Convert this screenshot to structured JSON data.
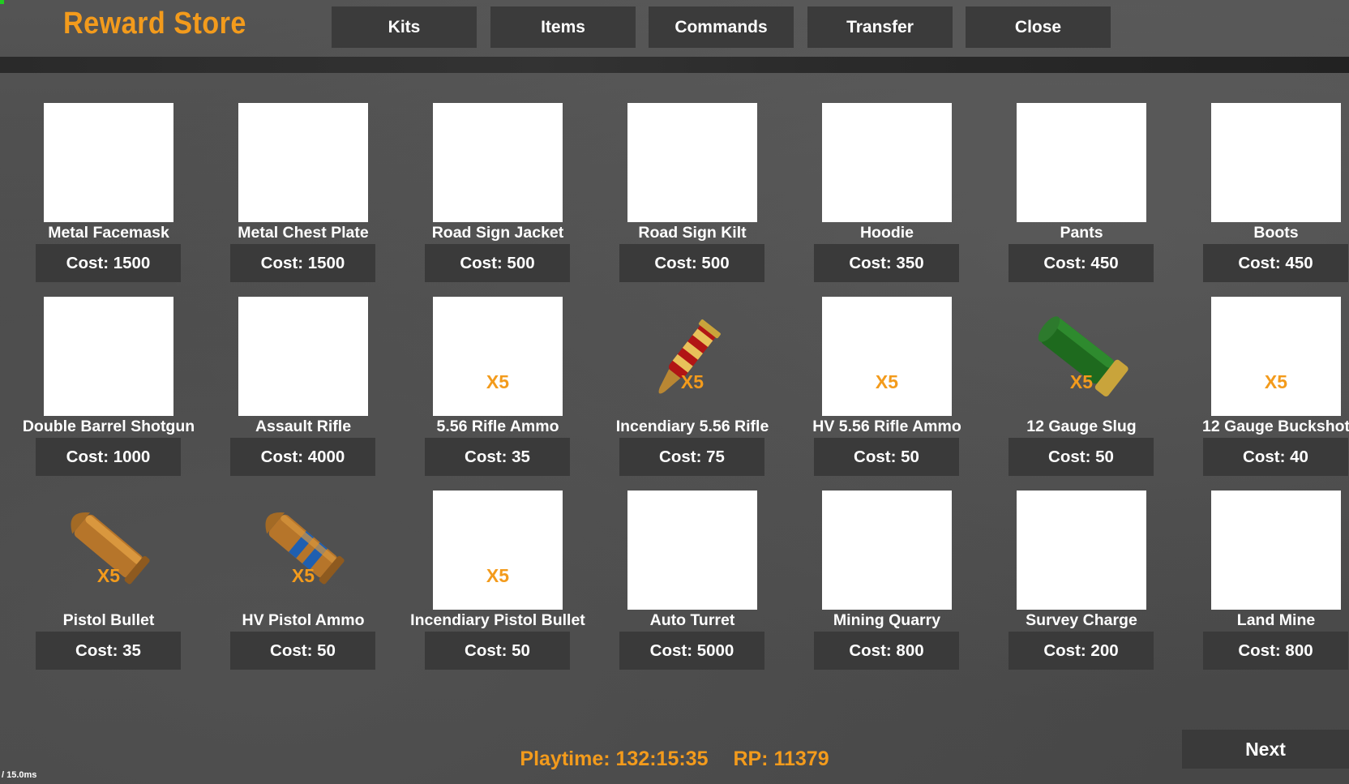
{
  "header": {
    "title": "Reward Store",
    "nav": [
      {
        "label": "Kits"
      },
      {
        "label": "Items"
      },
      {
        "label": "Commands"
      },
      {
        "label": "Transfer"
      },
      {
        "label": "Close"
      }
    ]
  },
  "items": [
    {
      "name": "Metal Facemask",
      "cost": "Cost: 1500",
      "qty": "",
      "icon": "blank-slot-icon"
    },
    {
      "name": "Metal Chest Plate",
      "cost": "Cost: 1500",
      "qty": "",
      "icon": "blank-slot-icon"
    },
    {
      "name": "Road Sign Jacket",
      "cost": "Cost: 500",
      "qty": "",
      "icon": "blank-slot-icon"
    },
    {
      "name": "Road Sign Kilt",
      "cost": "Cost: 500",
      "qty": "",
      "icon": "blank-slot-icon"
    },
    {
      "name": "Hoodie",
      "cost": "Cost: 350",
      "qty": "",
      "icon": "blank-slot-icon"
    },
    {
      "name": "Pants",
      "cost": "Cost: 450",
      "qty": "",
      "icon": "blank-slot-icon"
    },
    {
      "name": "Boots",
      "cost": "Cost: 450",
      "qty": "",
      "icon": "blank-slot-icon"
    },
    {
      "name": "Double Barrel Shotgun",
      "cost": "Cost: 1000",
      "qty": "",
      "icon": "blank-slot-icon"
    },
    {
      "name": "Assault Rifle",
      "cost": "Cost: 4000",
      "qty": "",
      "icon": "blank-slot-icon"
    },
    {
      "name": "5.56 Rifle Ammo",
      "cost": "Cost: 35",
      "qty": "X5",
      "icon": "blank-slot-icon"
    },
    {
      "name": "Incendiary 5.56 Rifle",
      "cost": "Cost: 75",
      "qty": "X5",
      "icon": "incendiary-rifle-bullet-icon"
    },
    {
      "name": "HV 5.56 Rifle Ammo",
      "cost": "Cost: 50",
      "qty": "X5",
      "icon": "blank-slot-icon"
    },
    {
      "name": "12 Gauge Slug",
      "cost": "Cost: 50",
      "qty": "X5",
      "icon": "shotgun-slug-shell-icon"
    },
    {
      "name": "12 Gauge Buckshot",
      "cost": "Cost: 40",
      "qty": "X5",
      "icon": "blank-slot-icon"
    },
    {
      "name": "Pistol Bullet",
      "cost": "Cost: 35",
      "qty": "X5",
      "icon": "pistol-bullet-icon"
    },
    {
      "name": "HV Pistol Ammo",
      "cost": "Cost: 50",
      "qty": "X5",
      "icon": "hv-pistol-bullet-icon"
    },
    {
      "name": "Incendiary Pistol Bullet",
      "cost": "Cost: 50",
      "qty": "X5",
      "icon": "blank-slot-icon"
    },
    {
      "name": "Auto Turret",
      "cost": "Cost: 5000",
      "qty": "",
      "icon": "blank-slot-icon"
    },
    {
      "name": "Mining Quarry",
      "cost": "Cost: 800",
      "qty": "",
      "icon": "blank-slot-icon"
    },
    {
      "name": "Survey Charge",
      "cost": "Cost: 200",
      "qty": "",
      "icon": "blank-slot-icon"
    },
    {
      "name": "Land Mine",
      "cost": "Cost: 800",
      "qty": "",
      "icon": "blank-slot-icon"
    }
  ],
  "footer": {
    "playtime": "Playtime: 132:15:35",
    "rp": "RP: 11379",
    "next_label": "Next"
  },
  "overlay": {
    "fps_text": "/ 15.0ms"
  },
  "colors": {
    "accent": "#f39b1c",
    "button_bg": "#3a3a3a"
  }
}
